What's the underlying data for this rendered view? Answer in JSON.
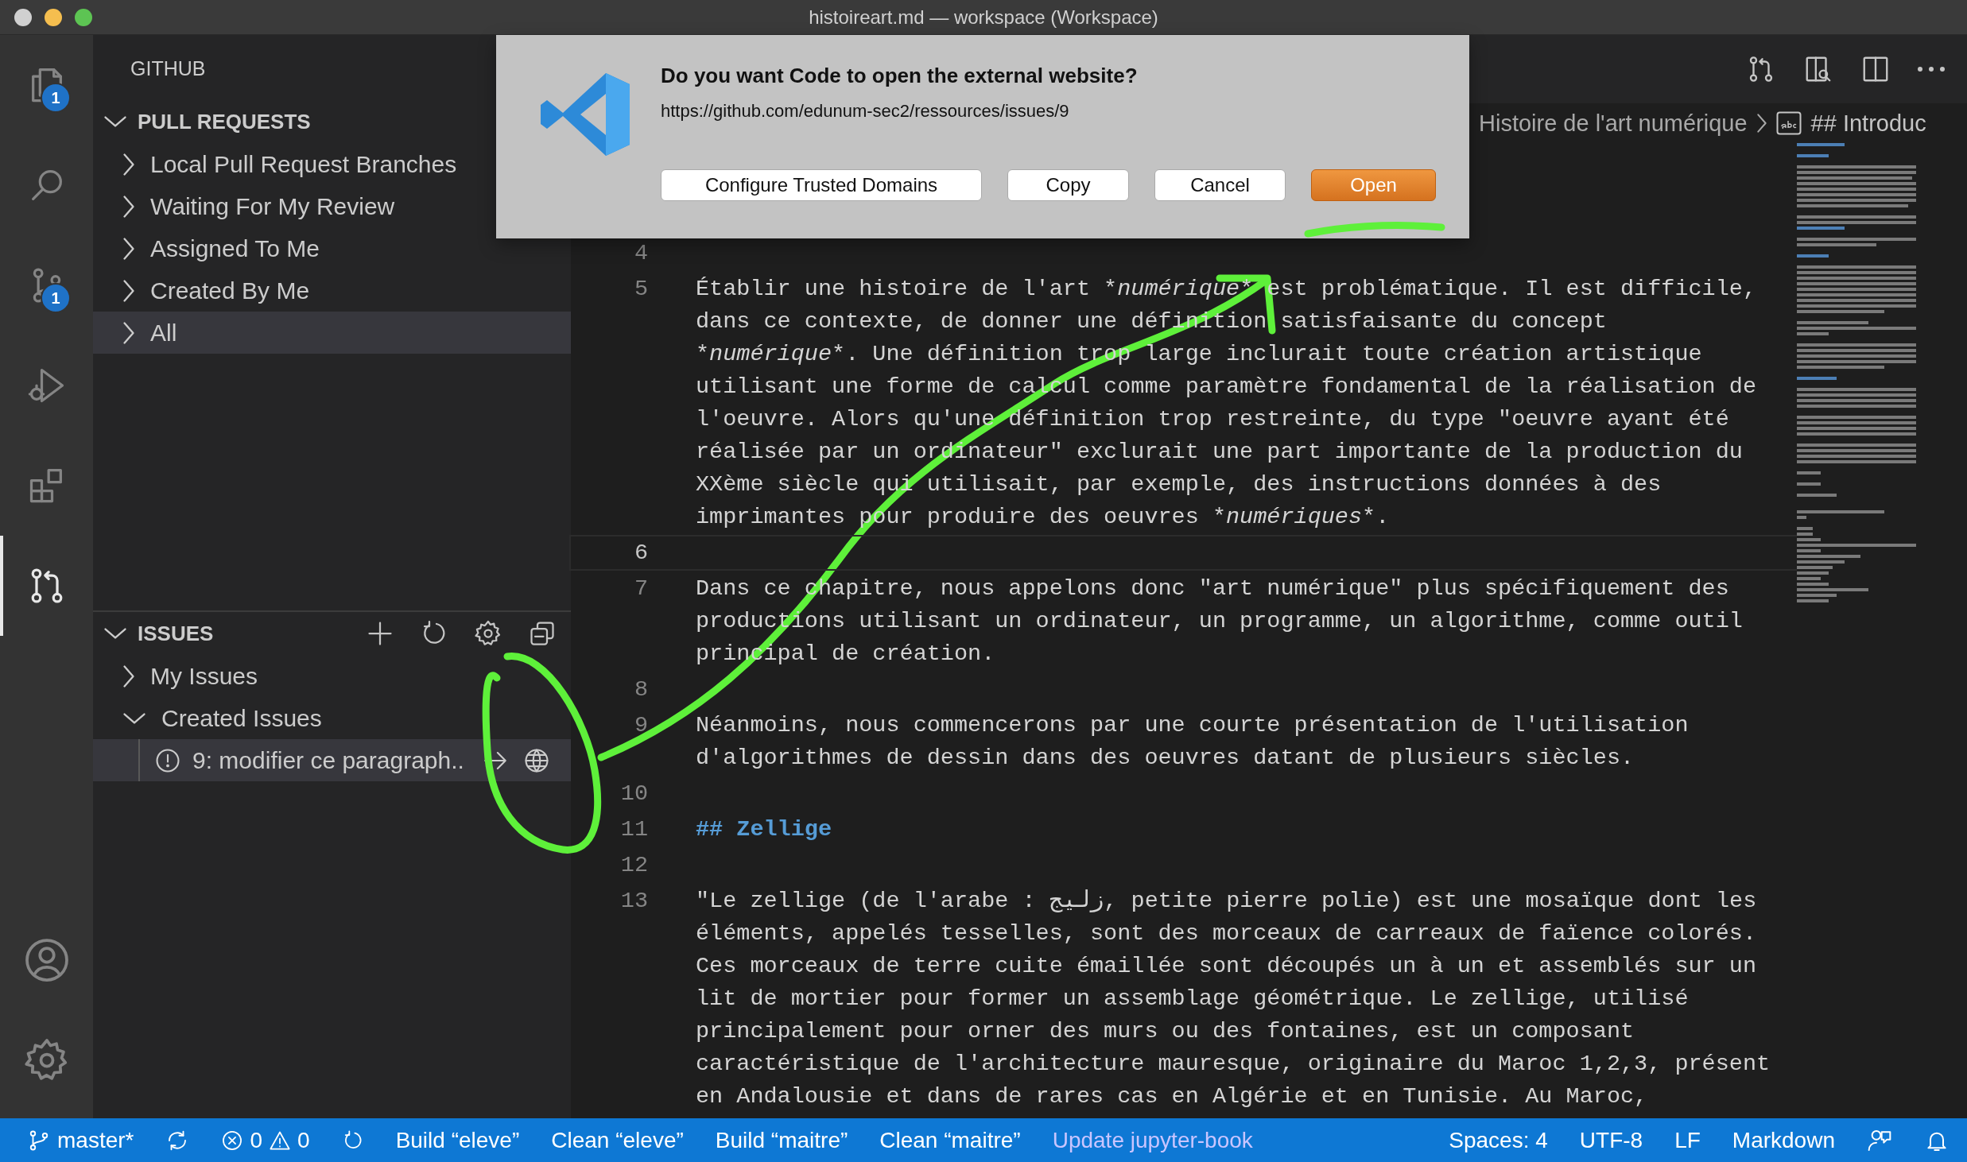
{
  "window": {
    "title": "histoireart.md — workspace (Workspace)"
  },
  "activity_bar": {
    "items": [
      {
        "kind": "explorer",
        "badge": "1",
        "selected": false
      },
      {
        "kind": "search",
        "selected": false
      },
      {
        "kind": "source-control",
        "badge": "1",
        "selected": false
      },
      {
        "kind": "run",
        "selected": false
      },
      {
        "kind": "extensions",
        "selected": false
      },
      {
        "kind": "pull-requests",
        "selected": true
      }
    ],
    "bottom": [
      {
        "kind": "account"
      },
      {
        "kind": "settings"
      }
    ]
  },
  "sidebar": {
    "title": "GITHUB",
    "sections": [
      {
        "title": "PULL REQUESTS",
        "expanded": true,
        "show_actions": false,
        "items": [
          {
            "label": "Local Pull Request Branches",
            "expanded": false,
            "selected": false
          },
          {
            "label": "Waiting For My Review",
            "expanded": false,
            "selected": false
          },
          {
            "label": "Assigned To Me",
            "expanded": false,
            "selected": false
          },
          {
            "label": "Created By Me",
            "expanded": false,
            "selected": false
          },
          {
            "label": "All",
            "expanded": false,
            "selected": true
          }
        ]
      },
      {
        "title": "ISSUES",
        "expanded": true,
        "show_actions": true,
        "items": [
          {
            "label": "My Issues",
            "expanded": false,
            "selected": false
          },
          {
            "label": "Created Issues",
            "expanded": true,
            "selected": false,
            "children": [
              {
                "label": "9: modifier ce paragraph..",
                "selected": true
              }
            ]
          }
        ]
      }
    ]
  },
  "editor": {
    "breadcrumb": [
      {
        "kind": "file",
        "label": "Histoire de l'art numérique"
      },
      {
        "kind": "symbol",
        "label": "## Introduc"
      }
    ],
    "lines": [
      {
        "number": "4",
        "kind": "blank",
        "current": false
      },
      {
        "number": "5",
        "kind": "text",
        "current": false,
        "segments": [
          {
            "text": "Établir une histoire de l'art *",
            "italic": false
          },
          {
            "text": "numérique",
            "italic": true
          },
          {
            "text": "* est problématique. Il est difficile, dans ce contexte, de donner une définition satisfaisante du concept *",
            "italic": false
          },
          {
            "text": "numérique",
            "italic": true
          },
          {
            "text": "*. Une définition trop large inclurait toute création artistique utilisant une forme de calcul comme paramètre fondamental de la réalisation de l'oeuvre. Alors qu'une définition trop restreinte, du type \"oeuvre ayant été réalisée par un ordinateur\" exclurait une part importante de la production du XXème siècle qui utilisait, par exemple, des instructions données à des imprimantes pour produire des oeuvres *",
            "italic": false
          },
          {
            "text": "numériques",
            "italic": true
          },
          {
            "text": "*.",
            "italic": false
          }
        ]
      },
      {
        "number": "6",
        "kind": "blank",
        "current": true
      },
      {
        "number": "7",
        "kind": "text",
        "current": false,
        "segments": [
          {
            "text": "Dans ce chapitre, nous appelons donc \"art numérique\" plus spécifiquement des productions utilisant un ordinateur, un programme, un algorithme, comme outil principal de création.",
            "italic": false
          }
        ]
      },
      {
        "number": "8",
        "kind": "blank",
        "current": false
      },
      {
        "number": "9",
        "kind": "text",
        "current": false,
        "segments": [
          {
            "text": "Néanmoins, nous commencerons par une courte présentation de l'utilisation d'algorithmes de dessin dans des oeuvres datant de plusieurs siècles.",
            "italic": false
          }
        ]
      },
      {
        "number": "10",
        "kind": "blank",
        "current": false
      },
      {
        "number": "11",
        "kind": "heading",
        "current": false,
        "segments": [
          {
            "text": "## Zellige",
            "italic": false
          }
        ]
      },
      {
        "number": "12",
        "kind": "blank",
        "current": false
      },
      {
        "number": "13",
        "kind": "text",
        "current": false,
        "segments": [
          {
            "text": "\"Le zellige (de l'arabe : زليج, petite pierre polie) est une mosaïque dont les éléments, appelés tesselles, sont des morceaux de carreaux de faïence colorés. Ces morceaux de terre cuite émaillée sont découpés un à un et assemblés sur un lit de mortier pour former un assemblage géométrique. Le zellige, utilisé principalement pour orner des murs ou des fontaines, est un composant caractéristique de l'architecture mauresque, originaire du Maroc 1,2,3, présent en Andalousie et dans de rares cas en Algérie et en Tunisie. Au Maroc,",
            "italic": false
          }
        ]
      }
    ]
  },
  "dialog": {
    "title": "Do you want Code to open the external website?",
    "url": "https://github.com/edunum-sec2/ressources/issues/9",
    "buttons": [
      {
        "label": "Configure Trusted Domains",
        "default": false
      },
      {
        "label": "Copy",
        "default": false
      },
      {
        "label": "Cancel",
        "default": false
      },
      {
        "label": "Open",
        "default": true
      }
    ]
  },
  "status_bar": {
    "left": [
      {
        "kind": "branch",
        "label": "master*"
      },
      {
        "kind": "sync"
      },
      {
        "kind": "problems",
        "errors": "0",
        "warnings": "0"
      },
      {
        "kind": "refresh"
      },
      {
        "kind": "task",
        "label": "Build “eleve”"
      },
      {
        "kind": "task",
        "label": "Clean “eleve”"
      },
      {
        "kind": "task",
        "label": "Build “maitre”"
      },
      {
        "kind": "task",
        "label": "Clean “maitre”"
      },
      {
        "kind": "link",
        "label": "Update jupyter-book"
      }
    ],
    "right": [
      "Spaces: 4",
      "UTF-8",
      "LF",
      "Markdown"
    ]
  }
}
